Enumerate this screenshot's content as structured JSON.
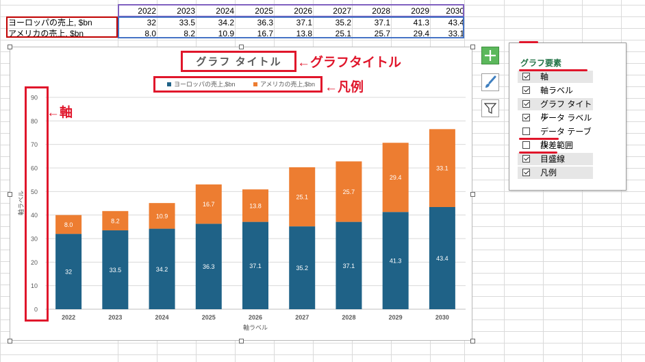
{
  "sheet": {
    "years": [
      "2022",
      "2023",
      "2024",
      "2025",
      "2026",
      "2027",
      "2028",
      "2029",
      "2030"
    ],
    "rows": [
      {
        "label": "ヨーロッパの売上, $bn",
        "values": [
          "32",
          "33.5",
          "34.2",
          "36.3",
          "37.1",
          "35.2",
          "37.1",
          "41.3",
          "43.4"
        ]
      },
      {
        "label": "アメリカの売上, $bn",
        "values": [
          "8.0",
          "8.2",
          "10.9",
          "16.7",
          "13.8",
          "25.1",
          "25.7",
          "29.4",
          "33.1"
        ]
      }
    ]
  },
  "chart_data": {
    "type": "bar",
    "stacked": true,
    "title": "グラフ タイトル",
    "xlabel": "軸ラベル",
    "ylabel": "軸ラベル",
    "categories": [
      "2022",
      "2023",
      "2024",
      "2025",
      "2026",
      "2027",
      "2028",
      "2029",
      "2030"
    ],
    "series": [
      {
        "name": "ヨーロッパの売上,$bn",
        "color": "#1f6287",
        "values": [
          32,
          33.5,
          34.2,
          36.3,
          37.1,
          35.2,
          37.1,
          41.3,
          43.4
        ],
        "labels": [
          "32",
          "33.5",
          "34.2",
          "36.3",
          "37.1",
          "35.2",
          "37.1",
          "41.3",
          "43.4"
        ]
      },
      {
        "name": "アメリカの売上,$bn",
        "color": "#ed7d31",
        "values": [
          8.0,
          8.2,
          10.9,
          16.7,
          13.8,
          25.1,
          25.7,
          29.4,
          33.1
        ],
        "labels": [
          "8.0",
          "8.2",
          "10.9",
          "16.7",
          "13.8",
          "25.1",
          "25.7",
          "29.4",
          "33.1"
        ]
      }
    ],
    "ylim": [
      0,
      90
    ],
    "yticks": [
      "0",
      "10",
      "20",
      "30",
      "40",
      "50",
      "60",
      "70",
      "80",
      "90"
    ],
    "grid": true,
    "legend_position": "top"
  },
  "annotations": {
    "title_label": "←グラフタイトル",
    "legend_label": "←凡例",
    "axis_label": "←軸",
    "color": "#e0162b"
  },
  "side_buttons": {
    "add": "plus-icon",
    "style": "brush-icon",
    "filter": "filter-icon"
  },
  "panel": {
    "title": "グラフ要素",
    "items": [
      {
        "label": "軸",
        "checked": true
      },
      {
        "label": "軸ラベル",
        "checked": true
      },
      {
        "label": "グラフ タイトル",
        "checked": true
      },
      {
        "label": "データ ラベル",
        "checked": true
      },
      {
        "label": "データ テーブル",
        "checked": false
      },
      {
        "label": "誤差範囲",
        "checked": false
      },
      {
        "label": "目盛線",
        "checked": true
      },
      {
        "label": "凡例",
        "checked": true
      }
    ]
  }
}
